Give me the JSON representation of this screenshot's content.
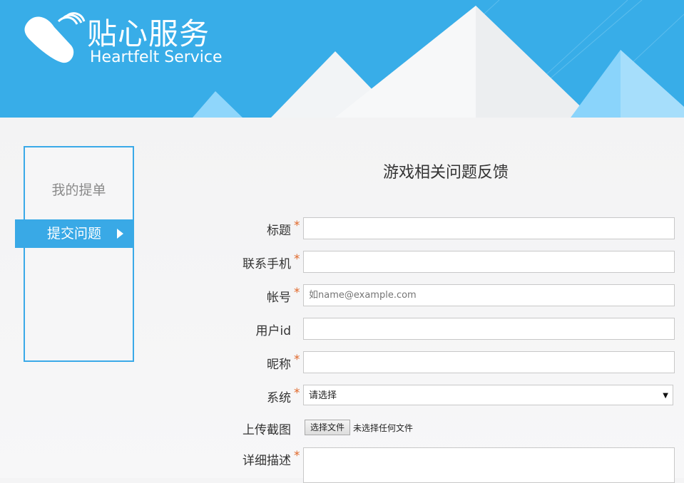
{
  "header": {
    "logo_cn": "贴心服务",
    "logo_en": "Heartfelt Service",
    "brand_color": "#38ade8"
  },
  "sidebar": {
    "items": [
      {
        "label": "我的提单",
        "active": false
      },
      {
        "label": "提交问题",
        "active": true
      }
    ]
  },
  "form": {
    "title": "游戏相关问题反馈",
    "fields": [
      {
        "label": "标题",
        "required": true,
        "value": "",
        "placeholder": ""
      },
      {
        "label": "联系手机",
        "required": true,
        "value": "",
        "placeholder": ""
      },
      {
        "label": "帐号",
        "required": true,
        "value": "",
        "placeholder": "如name@example.com"
      },
      {
        "label": "用户id",
        "required": false,
        "value": "",
        "placeholder": ""
      },
      {
        "label": "昵称",
        "required": true,
        "value": "",
        "placeholder": ""
      }
    ],
    "system": {
      "label": "系统",
      "required": true,
      "selected": "请选择"
    },
    "upload": {
      "label": "上传截图",
      "button": "选择文件",
      "status": "未选择任何文件"
    },
    "description": {
      "label": "详细描述",
      "required": true,
      "value": ""
    },
    "required_mark": "*"
  }
}
